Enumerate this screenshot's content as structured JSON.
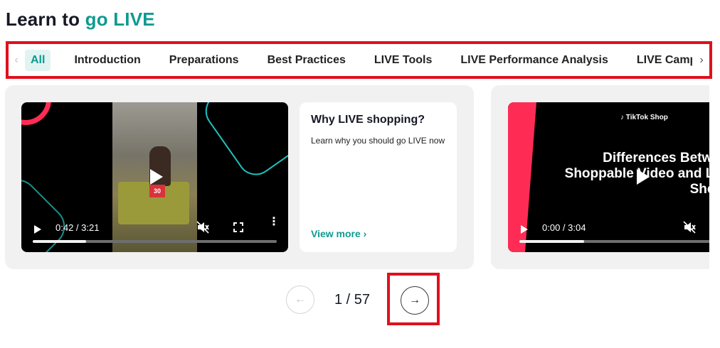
{
  "page": {
    "title_prefix": "Learn to",
    "title_accent": "go LIVE"
  },
  "tabs": {
    "items": [
      {
        "label": "All",
        "active": true
      },
      {
        "label": "Introduction"
      },
      {
        "label": "Preparations"
      },
      {
        "label": "Best Practices"
      },
      {
        "label": "LIVE Tools"
      },
      {
        "label": "LIVE Performance Analysis"
      },
      {
        "label": "LIVE Campai"
      }
    ],
    "left_arrow": "‹",
    "right_arrow": "›"
  },
  "cards": [
    {
      "video": {
        "time": "0:42 / 3:21",
        "progress": 0.22,
        "thumbnail_tag": "30"
      },
      "title": "Why LIVE shopping?",
      "description": "Learn why you should go LIVE now",
      "link": "View more ›"
    },
    {
      "video": {
        "time": "0:00 / 3:04",
        "progress": 0.28,
        "watermark": "♪ TikTok Shop",
        "slide_title": "Differences Between Shoppable Video and LIVE Shoppi"
      }
    }
  ],
  "pager": {
    "prev_icon": "←",
    "count": "1 / 57",
    "next_icon": "→"
  },
  "colors": {
    "accent": "#0f9a91",
    "highlight_border": "#e0101d",
    "brand_pink": "#fe2c55",
    "brand_cyan": "#25f4ee"
  }
}
